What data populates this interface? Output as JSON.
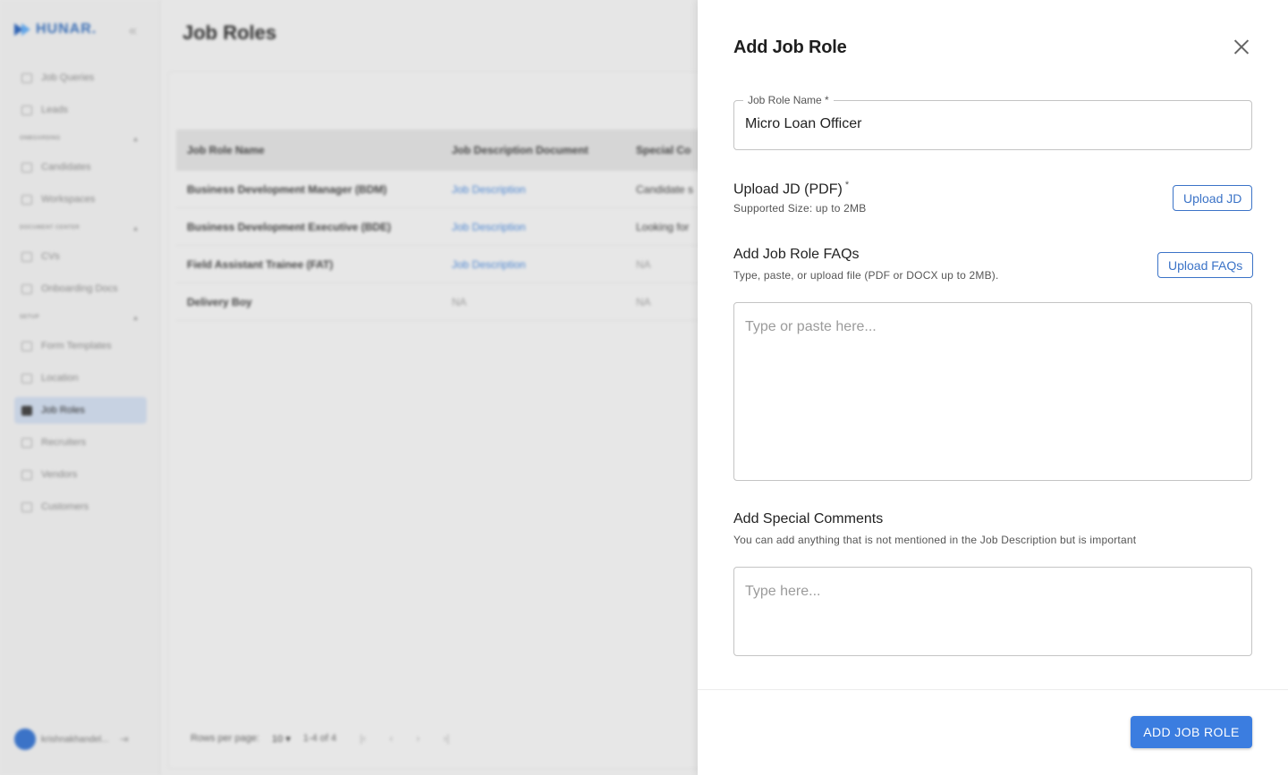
{
  "sidebar": {
    "brand": "HUNAR.",
    "items": [
      {
        "label": "Job Queries",
        "icon": "chat-icon"
      },
      {
        "label": "Leads",
        "icon": "list-icon"
      }
    ],
    "sections": [
      {
        "title": "ONBOARDING",
        "items": [
          {
            "label": "Candidates",
            "icon": "table-icon"
          },
          {
            "label": "Workspaces",
            "icon": "folder-icon"
          }
        ]
      },
      {
        "title": "DOCUMENT CENTER",
        "items": [
          {
            "label": "CVs",
            "icon": "document-icon"
          },
          {
            "label": "Onboarding Docs",
            "icon": "id-card-icon"
          }
        ]
      },
      {
        "title": "SETUP",
        "items": [
          {
            "label": "Form Templates",
            "icon": "form-icon"
          },
          {
            "label": "Location",
            "icon": "location-icon"
          },
          {
            "label": "Job Roles",
            "icon": "key-icon",
            "active": true
          },
          {
            "label": "Recruiters",
            "icon": "person-icon"
          },
          {
            "label": "Vendors",
            "icon": "store-icon"
          },
          {
            "label": "Customers",
            "icon": "building-icon"
          }
        ]
      }
    ],
    "user": "krishnakhandel..."
  },
  "main": {
    "title": "Job Roles",
    "columns": [
      "Job Role Name",
      "Job Description Document",
      "Special Co"
    ],
    "rows": [
      {
        "name": "Business Development Manager (BDM)",
        "doc": "Job Description",
        "comment": "Candidate s"
      },
      {
        "name": "Business Development Executive (BDE)",
        "doc": "Job Description",
        "comment": "Looking for"
      },
      {
        "name": "Field Assistant Trainee (FAT)",
        "doc": "Job Description",
        "comment": "NA"
      },
      {
        "name": "Delivery Boy",
        "doc": "NA",
        "comment": "NA"
      }
    ],
    "pagination": {
      "rows_label": "Rows per page:",
      "rows_value": "10",
      "range": "1-4 of 4"
    }
  },
  "drawer": {
    "title": "Add Job Role",
    "job_role_name": {
      "label": "Job Role Name *",
      "value": "Micro Loan Officer"
    },
    "upload_jd": {
      "title": "Upload JD (PDF)",
      "required": "*",
      "hint": "Supported Size: up to 2MB",
      "button": "Upload JD"
    },
    "faqs": {
      "title": "Add Job Role FAQs",
      "hint": "Type, paste, or upload file (PDF or DOCX up to 2MB).",
      "button": "Upload FAQs",
      "placeholder": "Type or paste here..."
    },
    "comments": {
      "title": "Add Special Comments",
      "hint": "You can add anything that is not mentioned in the Job Description but is important",
      "placeholder": "Type here..."
    },
    "submit": "ADD JOB ROLE"
  },
  "colors": {
    "primary": "#3b7de0",
    "accent_outline": "#3b73c7",
    "active_nav": "#c7d2e2"
  }
}
